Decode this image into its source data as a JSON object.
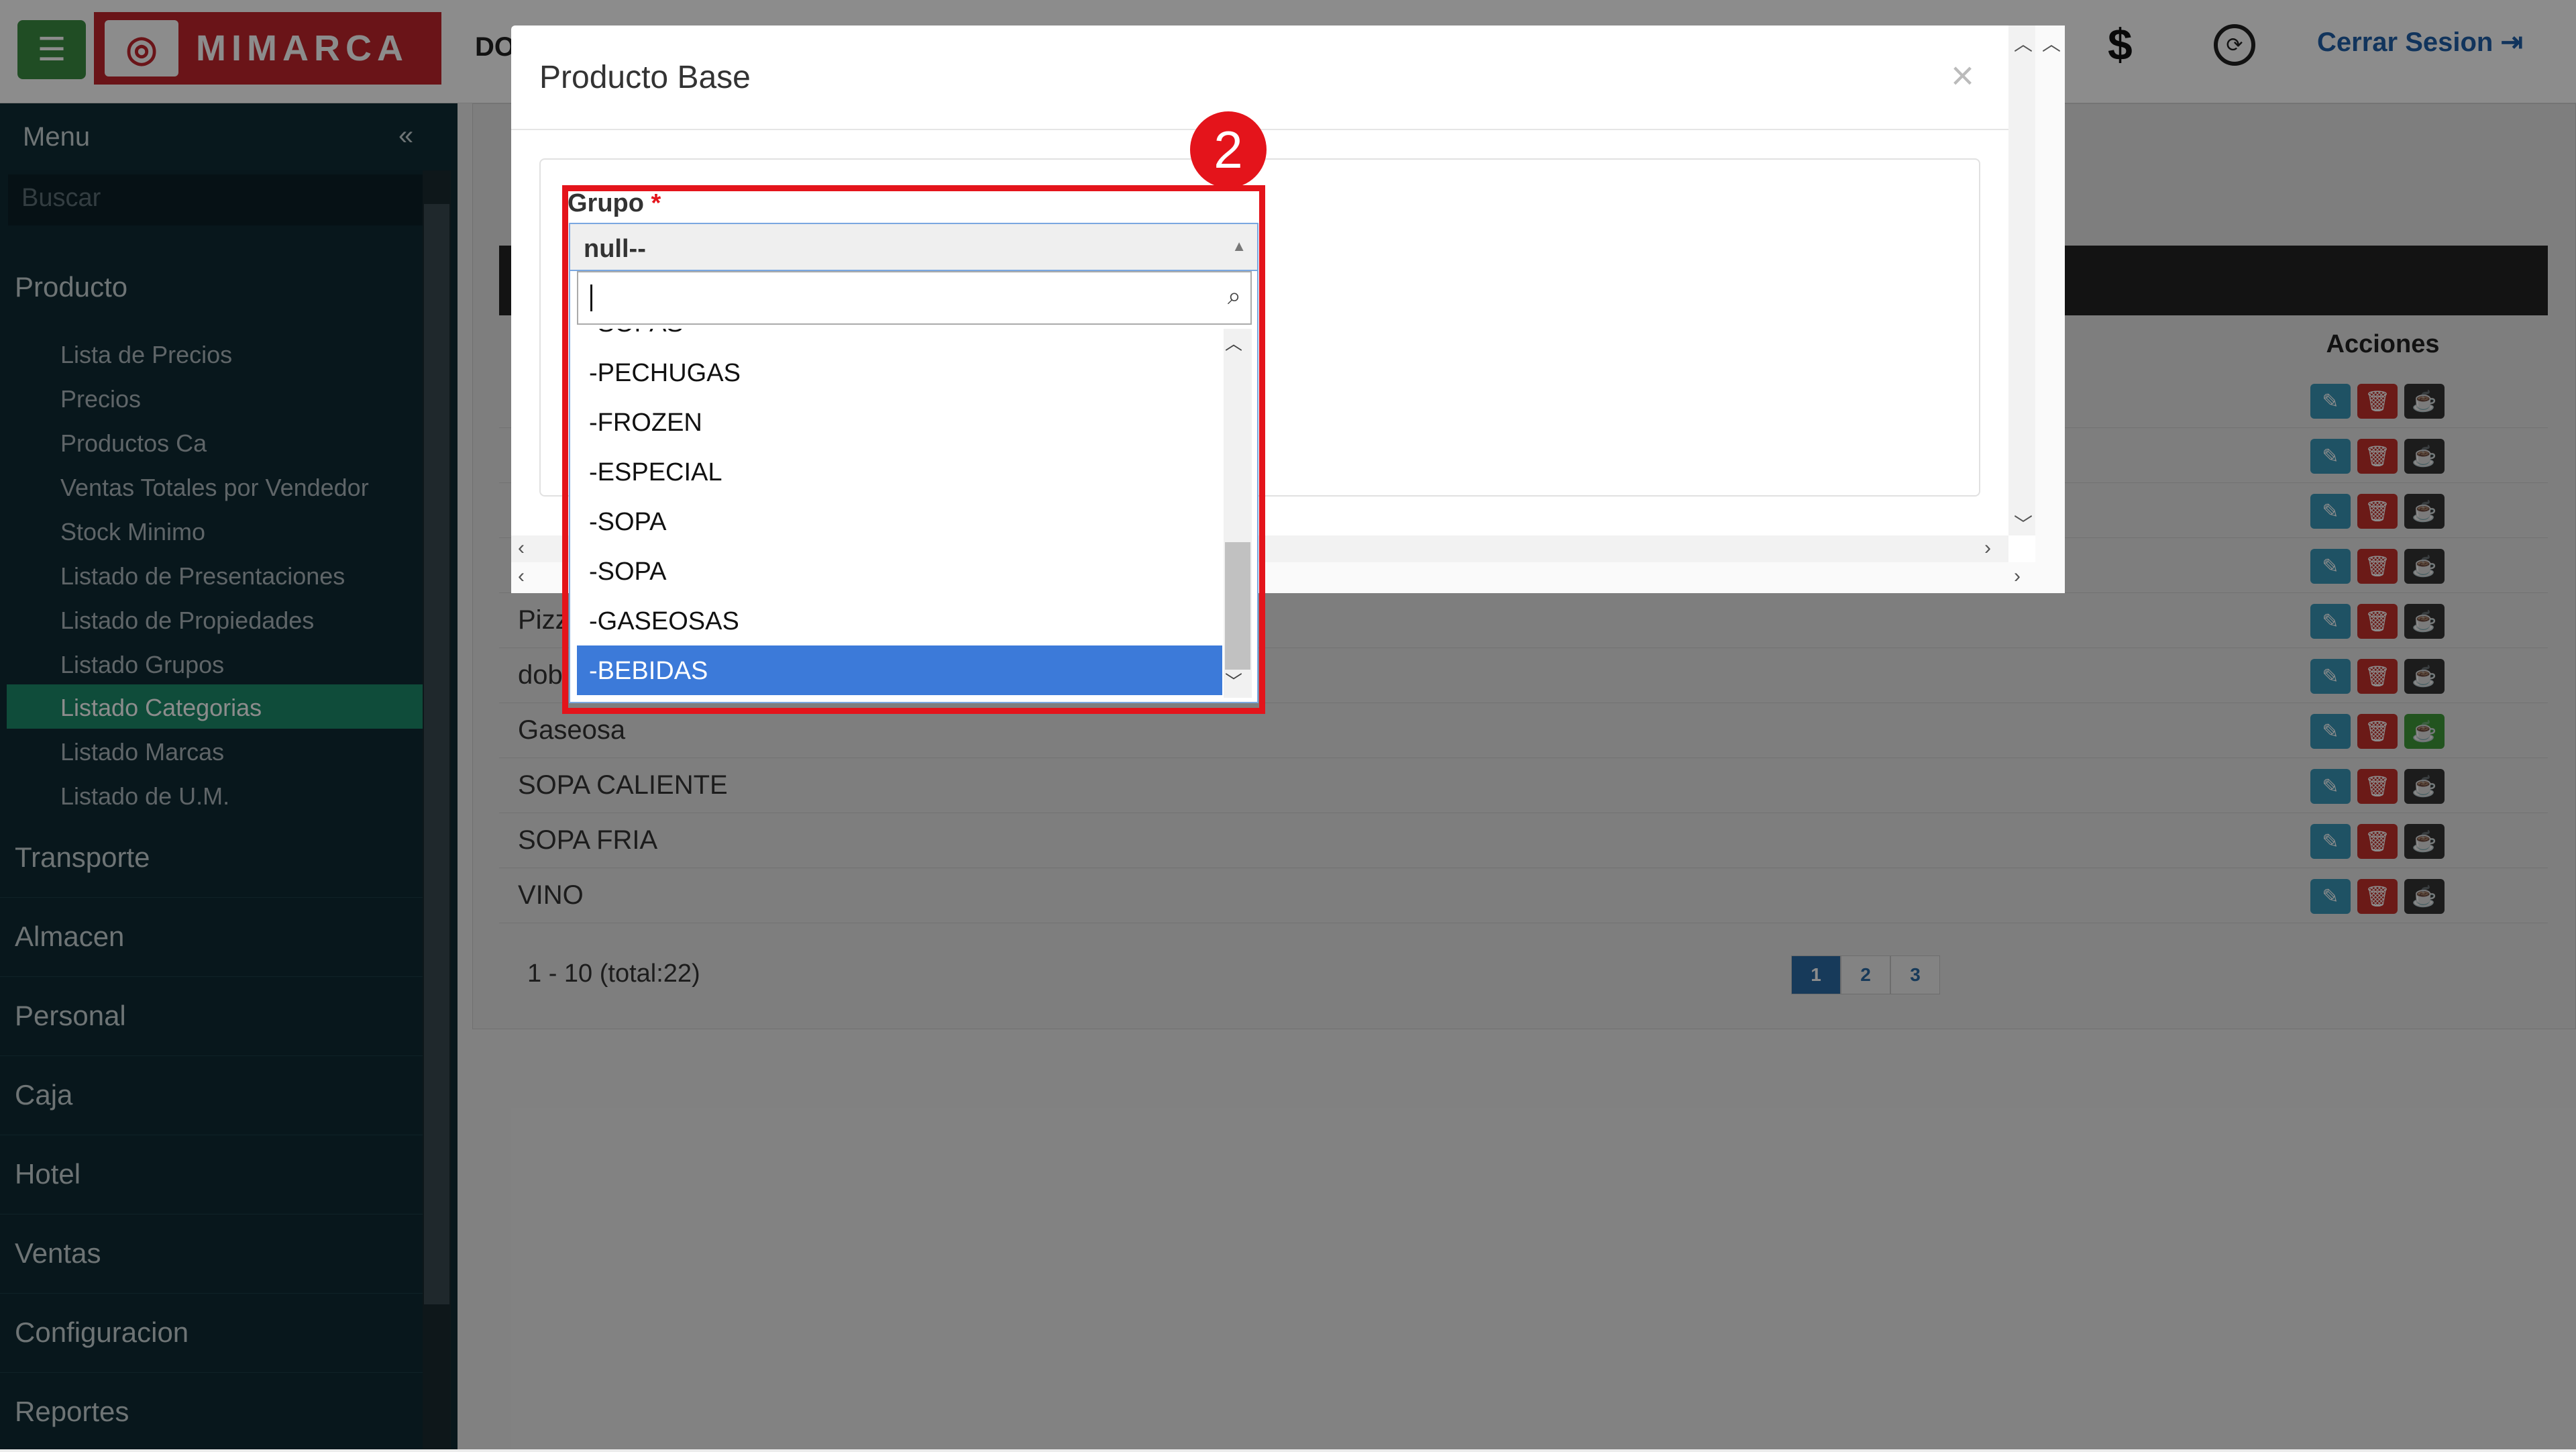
{
  "topbar": {
    "menu_icon": "☰",
    "brand_logo": "◎",
    "brand_name": "MIMARCA",
    "partial_text": "DO",
    "dollar_icon": "$",
    "lock_icon": "🔒",
    "logout_label": "Cerrar Sesion"
  },
  "sidebar": {
    "title": "Menu",
    "collapse_icon": "«",
    "search_placeholder": "Buscar",
    "sections": [
      {
        "label": "Producto"
      },
      {
        "label": "Transporte"
      },
      {
        "label": "Almacen"
      },
      {
        "label": "Personal"
      },
      {
        "label": "Caja"
      },
      {
        "label": "Hotel"
      },
      {
        "label": "Ventas"
      },
      {
        "label": "Configuracion"
      },
      {
        "label": "Reportes"
      }
    ],
    "producto_items": [
      "Lista de Precios",
      "Precios",
      "Productos Ca",
      "Ventas Totales por Vendedor",
      "Stock Minimo",
      "Listado de Presentaciones",
      "Listado de Propiedades",
      "Listado Grupos",
      "Listado Categorias",
      "Listado Marcas",
      "Listado de U.M."
    ],
    "active_item": "Listado Categorias"
  },
  "table": {
    "actions_header": "Acciones",
    "rows": [
      "Pizz",
      "dob",
      "Gaseosa",
      "SOPA CALIENTE",
      "SOPA FRIA",
      "VINO"
    ],
    "pagination_info": "1 - 10 (total:22)",
    "pages": [
      "1",
      "2",
      "3"
    ],
    "current_page": "1"
  },
  "modal": {
    "title": "Producto Base",
    "close_icon": "×",
    "field_label": "Grupo",
    "required_mark": "*",
    "selected_value": "null--",
    "options": [
      "-SOPAS",
      "-PECHUGAS",
      "-FROZEN",
      "-ESPECIAL",
      "-SOPA",
      "-SOPA",
      "-GASEOSAS",
      "-BEBIDAS"
    ],
    "highlighted_option": "-BEBIDAS",
    "step_badge": "2"
  },
  "colors": {
    "highlight_red": "#e4141b",
    "option_selected": "#3c7ad9",
    "sidebar_active": "#1c8a6b",
    "brand": "#c2262d"
  }
}
